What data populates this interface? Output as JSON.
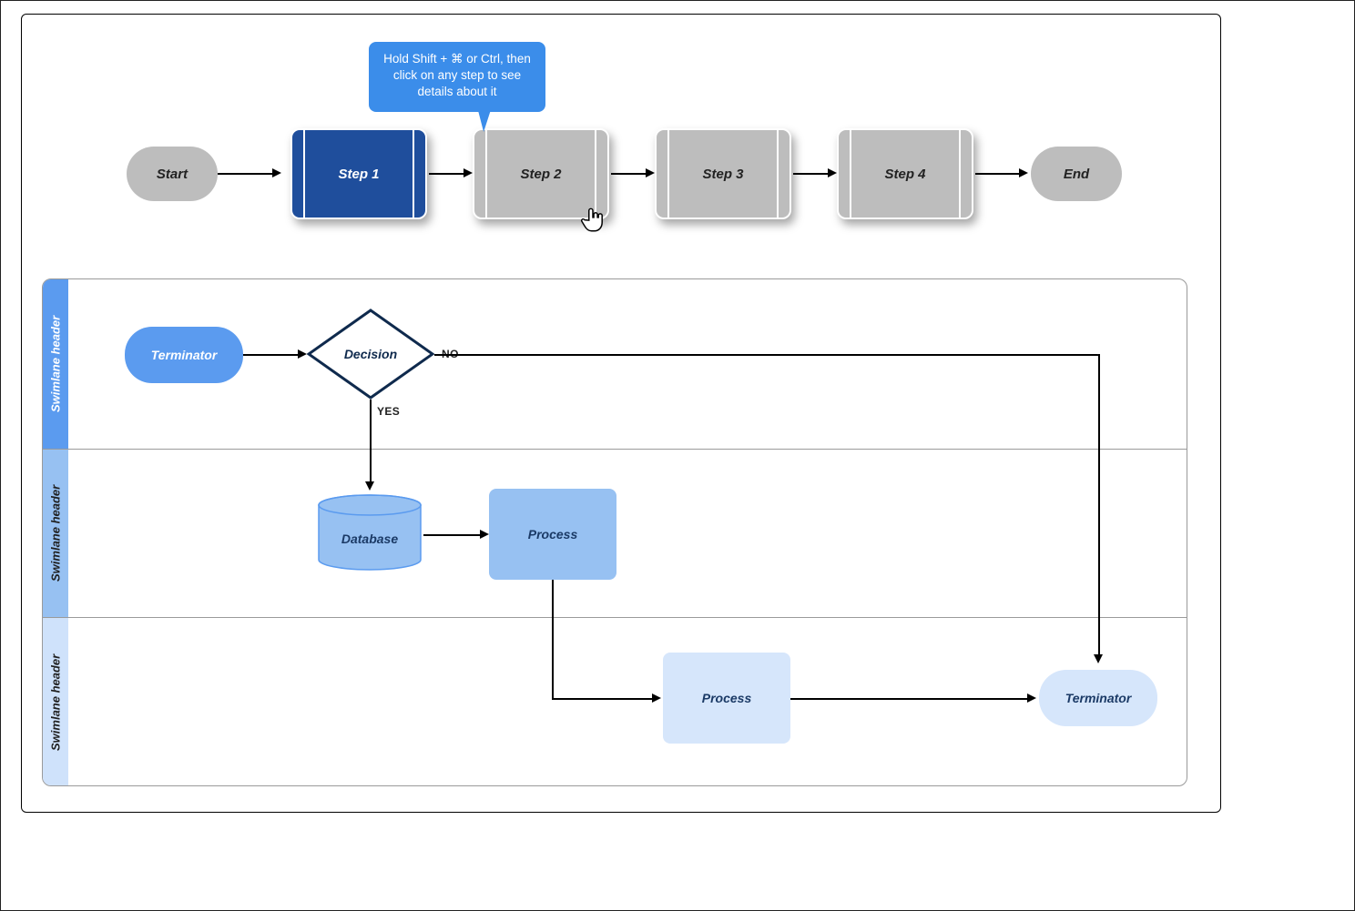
{
  "tooltip": {
    "text": "Hold Shift + ⌘ or Ctrl, then click on any step to see details about it"
  },
  "topFlow": {
    "start": "Start",
    "end": "End",
    "steps": [
      "Step 1",
      "Step 2",
      "Step 3",
      "Step 4"
    ],
    "activeIndex": 0
  },
  "swimlanes": {
    "headers": [
      "Swimlane header",
      "Swimlane header",
      "Swimlane header"
    ],
    "terminatorStart": "Terminator",
    "decision": "Decision",
    "decisionYes": "YES",
    "decisionNo": "NO",
    "database": "Database",
    "process1": "Process",
    "process2": "Process",
    "terminatorEnd": "Terminator"
  },
  "colors": {
    "stepActive": "#1f4e9c",
    "blueLight": "#5b9bef",
    "blueMid": "#97c1f2",
    "bluePale": "#d6e6fb",
    "navy": "#0f2a4d"
  }
}
